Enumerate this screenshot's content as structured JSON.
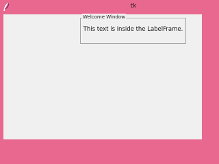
{
  "window": {
    "title": "tk",
    "icon": "feather-icon",
    "frame_color": "#e8688f",
    "client_bg": "#f0f0f0"
  },
  "labelframe": {
    "label": "Welcome Window",
    "text": "This text is inside the LabelFrame."
  }
}
